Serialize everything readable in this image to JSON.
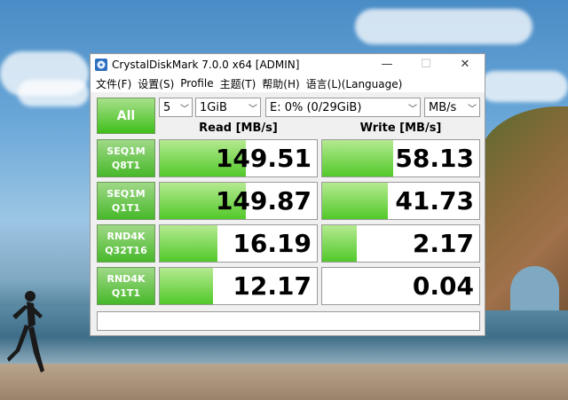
{
  "window": {
    "title": "CrystalDiskMark 7.0.0 x64 [ADMIN]",
    "controls": {
      "minimize": "—",
      "maximize": "☐",
      "close": "✕"
    }
  },
  "menu": [
    "文件(F)",
    "设置(S)",
    "Profile",
    "主题(T)",
    "帮助(H)",
    "语言(L)(Language)"
  ],
  "toolbar": {
    "all_label": "All",
    "count": "5",
    "size": "1GiB",
    "drive": "E: 0% (0/29GiB)",
    "unit": "MB/s"
  },
  "headers": {
    "read": "Read [MB/s]",
    "write": "Write [MB/s]"
  },
  "rows": [
    {
      "label1": "SEQ1M",
      "label2": "Q8T1",
      "read": "149.51",
      "write": "58.13",
      "read_fill": 0.55,
      "write_fill": 0.45
    },
    {
      "label1": "SEQ1M",
      "label2": "Q1T1",
      "read": "149.87",
      "write": "41.73",
      "read_fill": 0.55,
      "write_fill": 0.42
    },
    {
      "label1": "RND4K",
      "label2": "Q32T16",
      "read": "16.19",
      "write": "2.17",
      "read_fill": 0.37,
      "write_fill": 0.22
    },
    {
      "label1": "RND4K",
      "label2": "Q1T1",
      "read": "12.17",
      "write": "0.04",
      "read_fill": 0.34,
      "write_fill": 0.0
    }
  ],
  "colors": {
    "accent": "#3fbf1b",
    "bar_top": "#b4ea90",
    "bar_bottom": "#52c92a"
  }
}
